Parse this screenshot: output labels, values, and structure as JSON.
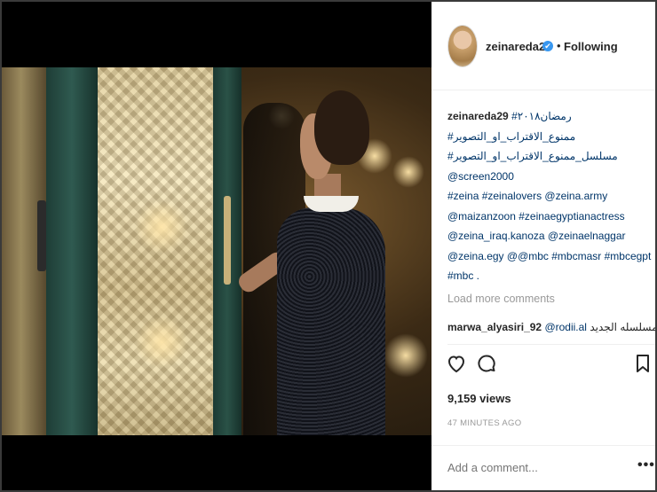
{
  "post": {
    "username": "zeinareda29",
    "verified_mark": "✔",
    "dot": "•",
    "follow_status": "Following"
  },
  "caption": {
    "user": "zeinareda29",
    "lines": [
      "رمضان٢٠١٨#",
      "#ممنوع_الاقتراب_او_التصوير",
      "#مسلسل_ممنوع_الاقتراب_او_التصوير",
      "@screen2000",
      "#zeina #zeinalovers @zeina.army",
      "@maizanzoon #zeinaegyptianactress",
      "@zeina_iraq.kanoza @zeinaelnaggar",
      "@zeina.egy @@mbc #mbcmasr #mbcegpt",
      "#mbc ."
    ]
  },
  "load_more_label": "Load more comments",
  "comment": {
    "user": "marwa_alyasiri_92",
    "mention": "@rodii.al",
    "text": "مسلسله الجديد"
  },
  "stats": {
    "views": "9,159 views",
    "time_ago": "47 MINUTES AGO"
  },
  "add_comment_placeholder": "Add a comment...",
  "more_options_label": "•••",
  "icons": {
    "like": "heart-icon",
    "comment": "comment-icon",
    "save": "bookmark-icon"
  },
  "colors": {
    "link": "#003569",
    "verified": "#3897f0",
    "muted": "#999999",
    "text": "#262626"
  }
}
